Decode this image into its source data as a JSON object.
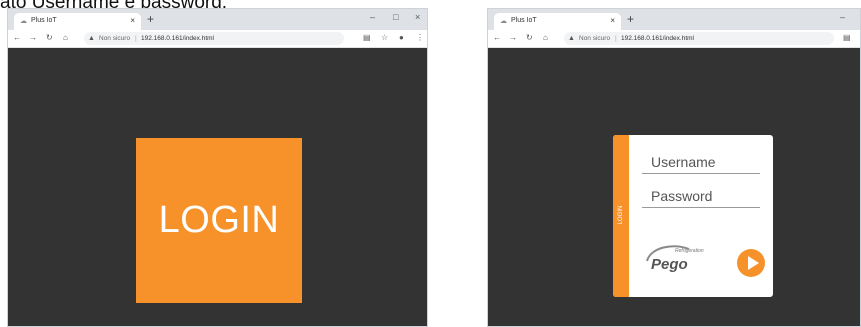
{
  "caption": "ato Username e password.",
  "left_browser": {
    "tab_title": "Plus IoT",
    "tab_close": "×",
    "new_tab": "+",
    "win_min": "–",
    "win_max": "□",
    "win_close": "×",
    "security": "Non sicuro",
    "separator": "|",
    "url": "192.168.0.161/index.html",
    "login_button": "LOGIN"
  },
  "right_browser": {
    "tab_title": "Plus IoT",
    "tab_close": "×",
    "new_tab": "+",
    "win_min": "–",
    "security": "Non sicuro",
    "separator": "|",
    "url": "192.168.0.161/index.html",
    "side_label": "LOGIN",
    "username_placeholder": "Username",
    "password_placeholder": "Password",
    "logo_small": "Refrigeration",
    "logo_main": "Pego"
  },
  "colors": {
    "accent": "#f7922b",
    "page_bg": "#333333"
  }
}
